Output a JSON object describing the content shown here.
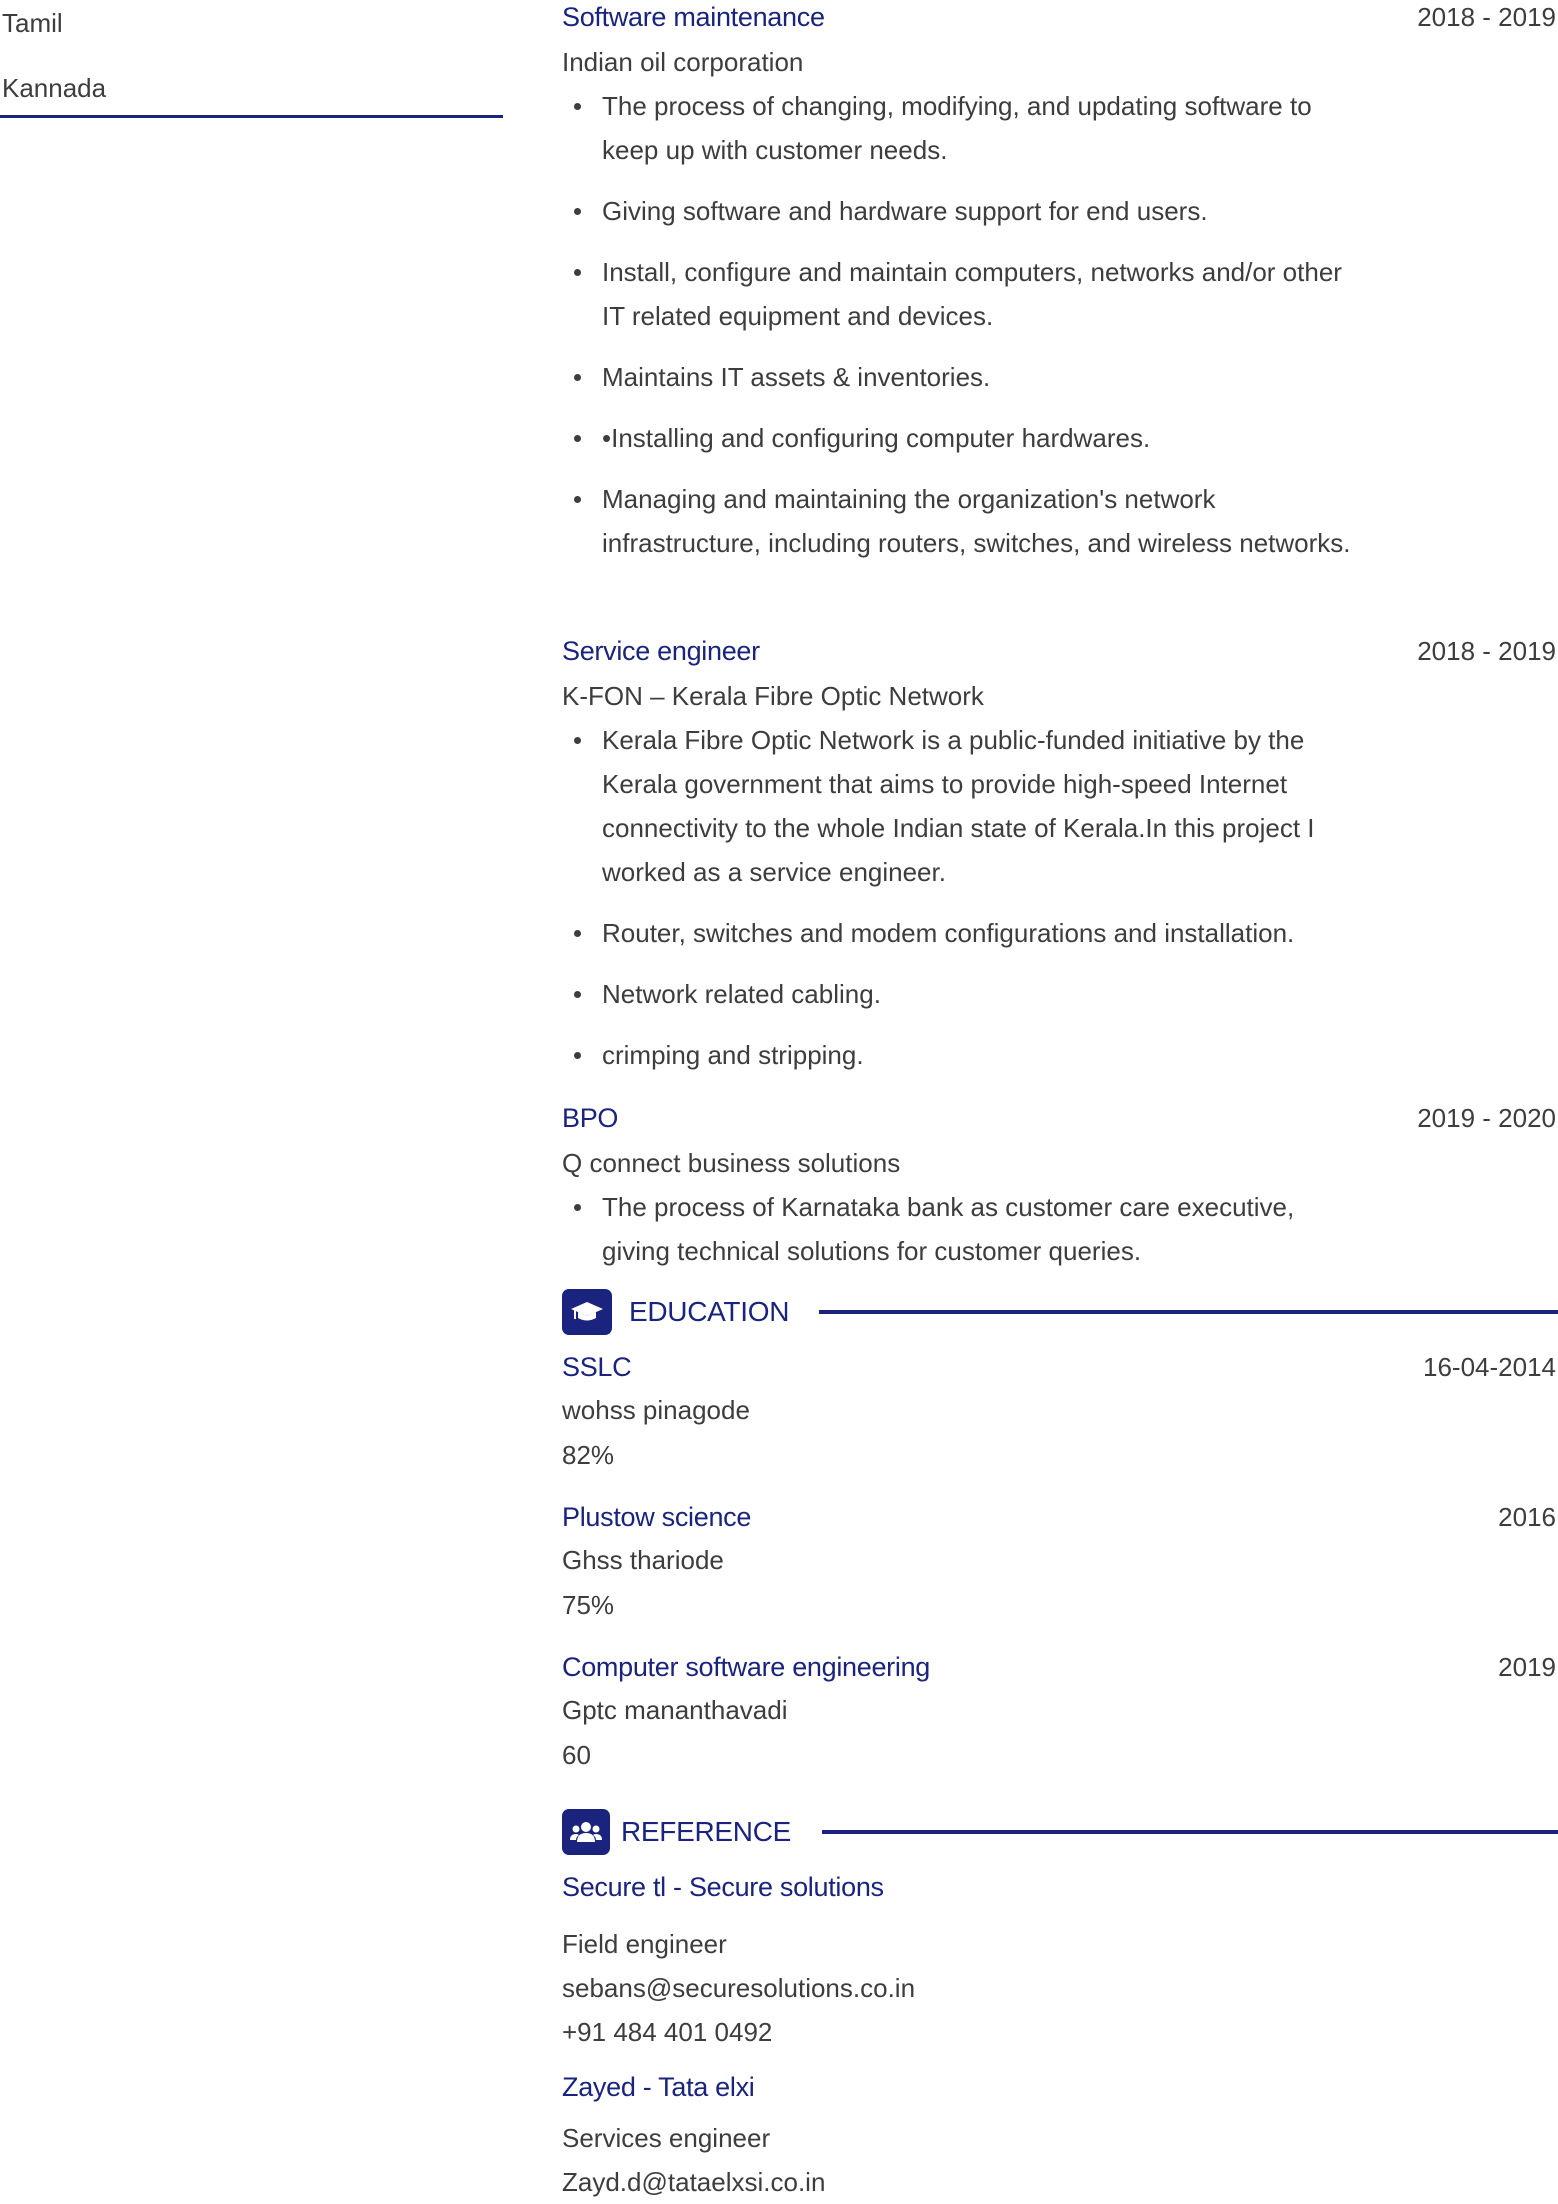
{
  "sidebar": {
    "languages": [
      "Tamil",
      "Kannada"
    ]
  },
  "experience": [
    {
      "title": "Software maintenance",
      "dates": "2018 - 2019",
      "company": "Indian oil corporation",
      "bullets": [
        "The process of changing, modifying, and updating software to keep up with customer needs.",
        "Giving software and hardware support for end users.",
        "Install, configure and maintain computers, networks and/or other IT related equipment and devices.",
        "Maintains IT assets & inventories.",
        "•Installing and configuring computer hardwares.",
        "Managing and maintaining the organization's network infrastructure, including routers, switches, and wireless networks."
      ]
    },
    {
      "title": "Service engineer",
      "dates": "2018 - 2019",
      "company": "K-FON – Kerala Fibre Optic Network",
      "bullets": [
        "Kerala Fibre Optic Network is a public-funded initiative by the Kerala government that aims to provide high-speed Internet connectivity to the whole Indian state of Kerala.In this project I worked as a service engineer.",
        "Router, switches and modem configurations and installation.",
        "Network related cabling.",
        "crimping and stripping."
      ]
    },
    {
      "title": "BPO",
      "dates": "2019 - 2020",
      "company": "Q connect business solutions",
      "bullets": [
        "The process of Karnataka bank as customer care executive, giving technical solutions for customer queries."
      ]
    }
  ],
  "education": {
    "heading": "EDUCATION",
    "icon": "graduation-cap-icon",
    "items": [
      {
        "degree": "SSLC",
        "date": "16-04-2014",
        "school": "wohss pinagode",
        "score": "82%"
      },
      {
        "degree": "Plustow science",
        "date": "2016",
        "school": "Ghss thariode",
        "score": "75%"
      },
      {
        "degree": "Computer software engineering",
        "date": "2019",
        "school": "Gptc mananthavadi",
        "score": "60"
      }
    ]
  },
  "reference": {
    "heading": "REFERENCE",
    "icon": "users-icon",
    "items": [
      {
        "name": "Secure tl - Secure solutions",
        "role": "Field engineer",
        "email": "sebans@securesolutions.co.in",
        "phone": "+91 484 401 0492"
      },
      {
        "name": "Zayed - Tata elxi",
        "role": "Services engineer",
        "email": "Zayd.d@tataelxsi.co.in"
      }
    ]
  },
  "colors": {
    "accent": "#1a237e",
    "text": "#3d3d3d"
  }
}
